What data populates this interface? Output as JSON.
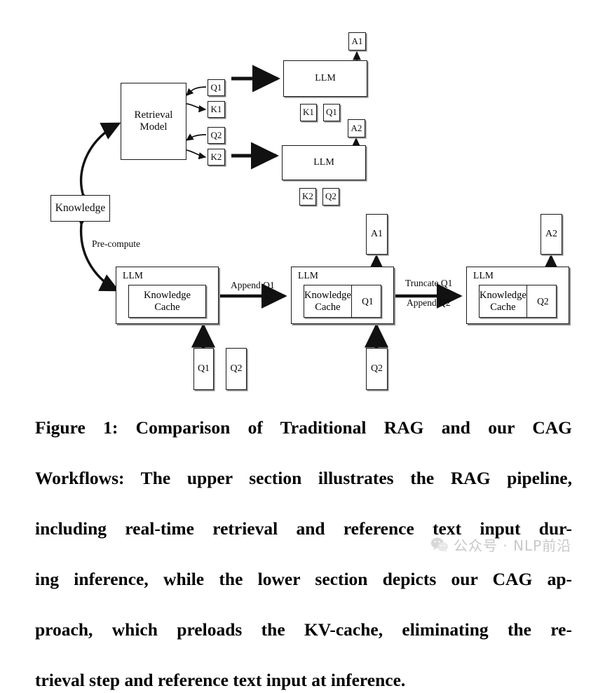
{
  "figure": {
    "caption_lines": [
      "Figure 1: Comparison of Traditional RAG and our CAG",
      "Workflows: The upper section illustrates the RAG pipeline,",
      "including real-time retrieval and reference text input dur-",
      "ing inference, while the lower section depicts our CAG ap-",
      "proach, which preloads the KV-cache, eliminating the re-",
      "trieval step and reference text input at inference."
    ],
    "caption_full": "Figure 1: Comparison of Traditional RAG and our CAG Workflows: The upper section illustrates the RAG pipeline, including real-time retrieval and reference text input during inference, while the lower section depicts our CAG approach, which preloads the KV-cache, eliminating the retrieval step and reference text input at inference."
  },
  "rag": {
    "retrieval_model": "Retrieval\nModel",
    "retrieval_model_line1": "Retrieval",
    "retrieval_model_line2": "Model",
    "knowledge": "Knowledge",
    "queries": [
      {
        "id": "q1",
        "label": "Q1"
      },
      {
        "id": "k1",
        "label": "K1"
      },
      {
        "id": "q2",
        "label": "Q2"
      },
      {
        "id": "k2",
        "label": "K2"
      }
    ],
    "llm_top": "LLM",
    "llm_bottom": "LLM",
    "answer_top": "A1",
    "answer_bottom": "A2",
    "inputs_top": [
      {
        "id": "k1-in",
        "label": "K1"
      },
      {
        "id": "q1-in",
        "label": "Q1"
      }
    ],
    "inputs_bottom": [
      {
        "id": "k2-in",
        "label": "K2"
      },
      {
        "id": "q2-in",
        "label": "Q2"
      }
    ]
  },
  "cag": {
    "precompute_label": "Pre-compute",
    "llm_label": "LLM",
    "knowledge_cache_line1": "Knowledge",
    "knowledge_cache_line2": "Cache",
    "stage1": {
      "llm": "LLM",
      "cache": "Knowledge Cache",
      "inputs": [
        {
          "id": "q1-slab",
          "label": "Q1"
        },
        {
          "id": "q2-slab",
          "label": "Q2"
        }
      ]
    },
    "stage2": {
      "llm": "LLM",
      "cache": "Knowledge Cache",
      "query": "Q1",
      "answer": "A1",
      "input": "Q2"
    },
    "stage3": {
      "llm": "LLM",
      "cache": "Knowledge Cache",
      "query": "Q2",
      "answer": "A2"
    },
    "edge_append_q1": "Append Q1",
    "edge_truncate_q1": "Truncate Q1",
    "edge_append_q2": "Append Q2"
  },
  "watermark": {
    "text": "公众号 · NLP前沿",
    "icon": "wechat-icon"
  },
  "colors": {
    "stroke": "#1a1a1a",
    "shadow": "#8a8a8a",
    "background": "#ffffff",
    "caption": "#000000",
    "watermark": "#b4b4b4"
  }
}
